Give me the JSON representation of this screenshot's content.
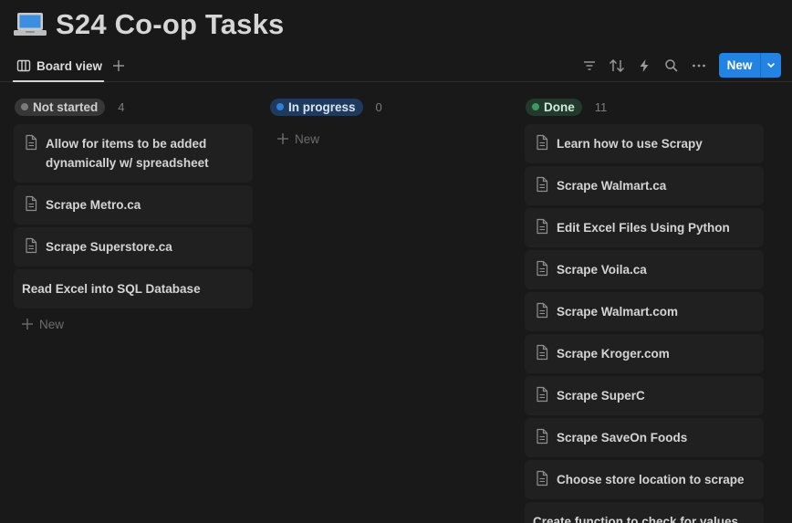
{
  "page": {
    "title": "S24 Co-op Tasks",
    "icon": "laptop-icon"
  },
  "toolbar": {
    "view_label": "Board view",
    "new_label": "New",
    "icons": [
      "filter-icon",
      "sort-icon",
      "automation-icon",
      "search-icon",
      "more-icon"
    ]
  },
  "columns": [
    {
      "status": "Not started",
      "count": "4",
      "pill_bg": "#373737",
      "pill_text": "#d0d0d0",
      "dot": "#7a7a7a",
      "cards": [
        {
          "title": "Allow for items to be added dynamically w/ spreadsheet",
          "icon": true
        },
        {
          "title": "Scrape Metro.ca",
          "icon": true
        },
        {
          "title": "Scrape Superstore.ca",
          "icon": true
        },
        {
          "title": "Read Excel into SQL Database",
          "icon": false
        }
      ],
      "new_label": "New"
    },
    {
      "status": "In progress",
      "count": "0",
      "pill_bg": "#1f3a5c",
      "pill_text": "#d6e6f7",
      "dot": "#2f7fd8",
      "cards": [],
      "new_label": "New"
    },
    {
      "status": "Done",
      "count": "11",
      "pill_bg": "#213a2c",
      "pill_text": "#d4e9dc",
      "dot": "#3c9a63",
      "cards": [
        {
          "title": "Learn how to use Scrapy",
          "icon": true
        },
        {
          "title": "Scrape Walmart.ca",
          "icon": true
        },
        {
          "title": "Edit Excel Files Using Python",
          "icon": true
        },
        {
          "title": "Scrape Voila.ca",
          "icon": true
        },
        {
          "title": "Scrape Walmart.com",
          "icon": true
        },
        {
          "title": "Scrape Kroger.com",
          "icon": true
        },
        {
          "title": "Scrape SuperC",
          "icon": true
        },
        {
          "title": "Scrape SaveOn Foods",
          "icon": true
        },
        {
          "title": "Choose store location to scrape",
          "icon": true
        },
        {
          "title": "Create function to check for values",
          "icon": false
        }
      ]
    }
  ]
}
